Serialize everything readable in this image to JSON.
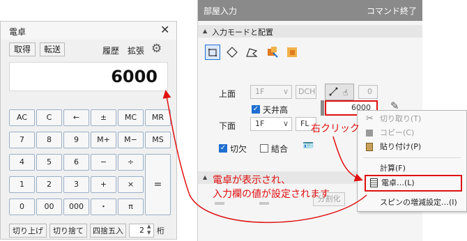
{
  "calculator": {
    "title": "電卓",
    "top_buttons": [
      "取得",
      "転送"
    ],
    "top_links": [
      "履歴",
      "拡張"
    ],
    "display": "6000",
    "keys": [
      [
        "AC",
        "C",
        "←",
        "±",
        "MC",
        "MR"
      ],
      [
        "7",
        "8",
        "9",
        "M+",
        "M−",
        "MS"
      ],
      [
        "4",
        "5",
        "6",
        "−",
        "÷"
      ],
      [
        "1",
        "2",
        "3",
        "+",
        "×",
        "="
      ],
      [
        "0",
        "00",
        "000",
        "・",
        "π"
      ]
    ],
    "bottom_buttons": [
      "切り上げ",
      "切り捨て",
      "四捨五入"
    ],
    "digits_value": "2",
    "digits_label": "桁"
  },
  "panel": {
    "title": "部屋入力",
    "command_end": "コマンド終了",
    "section": "入力モードと配置",
    "upper_label": "上面",
    "upper_floor": "1F",
    "upper_ref": "DCH",
    "upper_value": "0",
    "ceiling_label": "天井高",
    "ceiling_value": "6000",
    "lower_label": "下面",
    "lower_floor": "1F",
    "lower_ref": "FL",
    "cutout_label": "切欠",
    "join_label": "結合",
    "bottom_button": "分割化"
  },
  "context_menu": {
    "items": [
      {
        "label": "切り取り(T)",
        "icon": "scissors-icon",
        "enabled": false
      },
      {
        "label": "コピー(C)",
        "icon": "copy-icon",
        "enabled": false
      },
      {
        "label": "貼り付け(P)",
        "icon": "paste-icon",
        "enabled": true
      },
      {
        "label": "計算(F)",
        "icon": "",
        "enabled": true
      },
      {
        "label": "電卓…(L)",
        "icon": "calculator-icon",
        "enabled": true
      },
      {
        "label": "スピンの増減設定…(I)",
        "icon": "",
        "enabled": true
      }
    ]
  },
  "annotations": {
    "right_click": "右クリック",
    "result_line1": "電卓が表示され、",
    "result_line2": "入力欄の値が設定されます"
  },
  "colors": {
    "accent_red": "#e01010",
    "header_gray": "#8a8a8a",
    "check_blue": "#1f6fd0"
  }
}
